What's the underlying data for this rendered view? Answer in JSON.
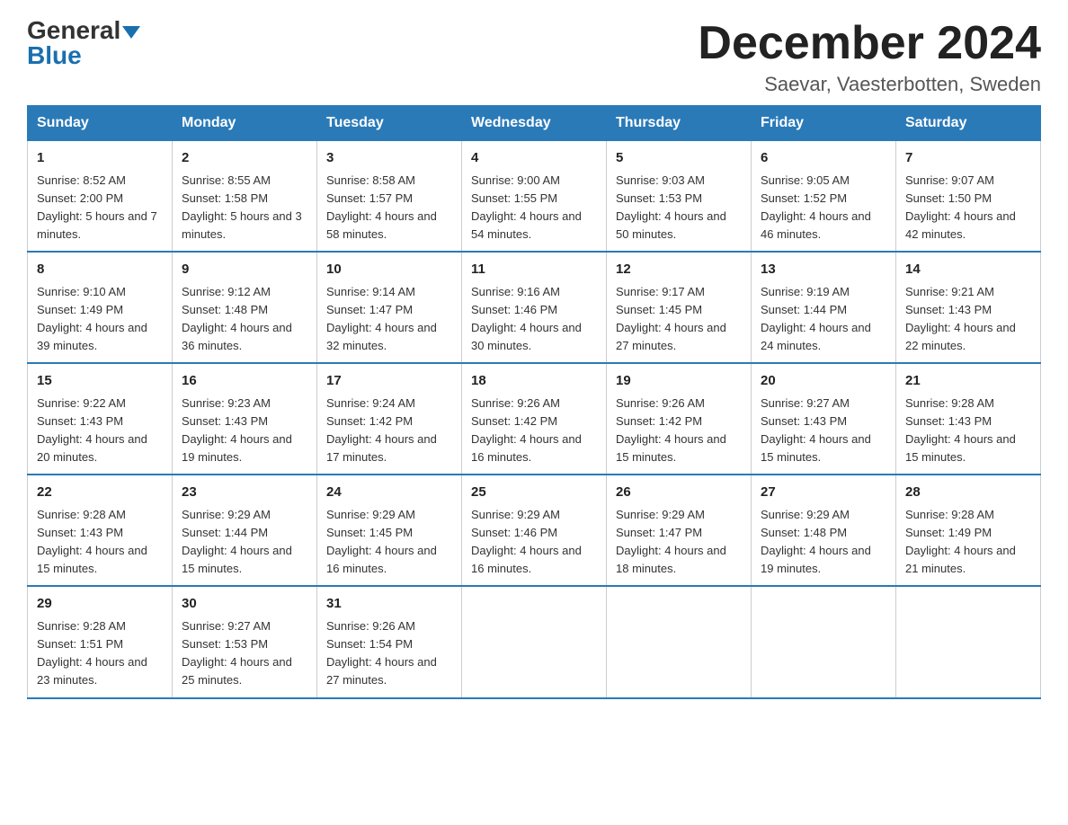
{
  "header": {
    "logo_line1": "General",
    "logo_line2": "Blue",
    "main_title": "December 2024",
    "subtitle": "Saevar, Vaesterbotten, Sweden"
  },
  "days_of_week": [
    "Sunday",
    "Monday",
    "Tuesday",
    "Wednesday",
    "Thursday",
    "Friday",
    "Saturday"
  ],
  "weeks": [
    [
      {
        "day": "1",
        "sunrise": "8:52 AM",
        "sunset": "2:00 PM",
        "daylight": "5 hours and 7 minutes."
      },
      {
        "day": "2",
        "sunrise": "8:55 AM",
        "sunset": "1:58 PM",
        "daylight": "5 hours and 3 minutes."
      },
      {
        "day": "3",
        "sunrise": "8:58 AM",
        "sunset": "1:57 PM",
        "daylight": "4 hours and 58 minutes."
      },
      {
        "day": "4",
        "sunrise": "9:00 AM",
        "sunset": "1:55 PM",
        "daylight": "4 hours and 54 minutes."
      },
      {
        "day": "5",
        "sunrise": "9:03 AM",
        "sunset": "1:53 PM",
        "daylight": "4 hours and 50 minutes."
      },
      {
        "day": "6",
        "sunrise": "9:05 AM",
        "sunset": "1:52 PM",
        "daylight": "4 hours and 46 minutes."
      },
      {
        "day": "7",
        "sunrise": "9:07 AM",
        "sunset": "1:50 PM",
        "daylight": "4 hours and 42 minutes."
      }
    ],
    [
      {
        "day": "8",
        "sunrise": "9:10 AM",
        "sunset": "1:49 PM",
        "daylight": "4 hours and 39 minutes."
      },
      {
        "day": "9",
        "sunrise": "9:12 AM",
        "sunset": "1:48 PM",
        "daylight": "4 hours and 36 minutes."
      },
      {
        "day": "10",
        "sunrise": "9:14 AM",
        "sunset": "1:47 PM",
        "daylight": "4 hours and 32 minutes."
      },
      {
        "day": "11",
        "sunrise": "9:16 AM",
        "sunset": "1:46 PM",
        "daylight": "4 hours and 30 minutes."
      },
      {
        "day": "12",
        "sunrise": "9:17 AM",
        "sunset": "1:45 PM",
        "daylight": "4 hours and 27 minutes."
      },
      {
        "day": "13",
        "sunrise": "9:19 AM",
        "sunset": "1:44 PM",
        "daylight": "4 hours and 24 minutes."
      },
      {
        "day": "14",
        "sunrise": "9:21 AM",
        "sunset": "1:43 PM",
        "daylight": "4 hours and 22 minutes."
      }
    ],
    [
      {
        "day": "15",
        "sunrise": "9:22 AM",
        "sunset": "1:43 PM",
        "daylight": "4 hours and 20 minutes."
      },
      {
        "day": "16",
        "sunrise": "9:23 AM",
        "sunset": "1:43 PM",
        "daylight": "4 hours and 19 minutes."
      },
      {
        "day": "17",
        "sunrise": "9:24 AM",
        "sunset": "1:42 PM",
        "daylight": "4 hours and 17 minutes."
      },
      {
        "day": "18",
        "sunrise": "9:26 AM",
        "sunset": "1:42 PM",
        "daylight": "4 hours and 16 minutes."
      },
      {
        "day": "19",
        "sunrise": "9:26 AM",
        "sunset": "1:42 PM",
        "daylight": "4 hours and 15 minutes."
      },
      {
        "day": "20",
        "sunrise": "9:27 AM",
        "sunset": "1:43 PM",
        "daylight": "4 hours and 15 minutes."
      },
      {
        "day": "21",
        "sunrise": "9:28 AM",
        "sunset": "1:43 PM",
        "daylight": "4 hours and 15 minutes."
      }
    ],
    [
      {
        "day": "22",
        "sunrise": "9:28 AM",
        "sunset": "1:43 PM",
        "daylight": "4 hours and 15 minutes."
      },
      {
        "day": "23",
        "sunrise": "9:29 AM",
        "sunset": "1:44 PM",
        "daylight": "4 hours and 15 minutes."
      },
      {
        "day": "24",
        "sunrise": "9:29 AM",
        "sunset": "1:45 PM",
        "daylight": "4 hours and 16 minutes."
      },
      {
        "day": "25",
        "sunrise": "9:29 AM",
        "sunset": "1:46 PM",
        "daylight": "4 hours and 16 minutes."
      },
      {
        "day": "26",
        "sunrise": "9:29 AM",
        "sunset": "1:47 PM",
        "daylight": "4 hours and 18 minutes."
      },
      {
        "day": "27",
        "sunrise": "9:29 AM",
        "sunset": "1:48 PM",
        "daylight": "4 hours and 19 minutes."
      },
      {
        "day": "28",
        "sunrise": "9:28 AM",
        "sunset": "1:49 PM",
        "daylight": "4 hours and 21 minutes."
      }
    ],
    [
      {
        "day": "29",
        "sunrise": "9:28 AM",
        "sunset": "1:51 PM",
        "daylight": "4 hours and 23 minutes."
      },
      {
        "day": "30",
        "sunrise": "9:27 AM",
        "sunset": "1:53 PM",
        "daylight": "4 hours and 25 minutes."
      },
      {
        "day": "31",
        "sunrise": "9:26 AM",
        "sunset": "1:54 PM",
        "daylight": "4 hours and 27 minutes."
      },
      null,
      null,
      null,
      null
    ]
  ]
}
